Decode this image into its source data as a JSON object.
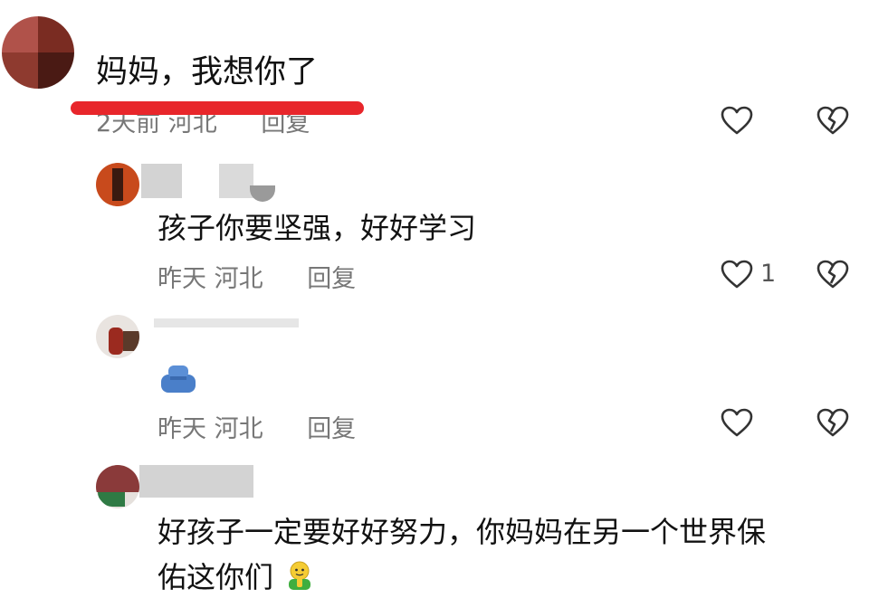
{
  "colors": {
    "text": "#111111",
    "meta": "#777777",
    "highlight_underline": "#e8262b",
    "icon_stroke": "#333333"
  },
  "comments": [
    {
      "text": "妈妈，我想你了",
      "meta": {
        "time": "2天前",
        "location": "河北",
        "reply": "回复"
      },
      "like_icon": "heart-outline-icon",
      "dislike_icon": "broken-heart-icon"
    },
    {
      "text": "孩子你要坚强，好好学习",
      "meta": {
        "time": "昨天",
        "location": "河北",
        "reply": "回复"
      },
      "like_count": "1",
      "like_icon": "heart-outline-icon",
      "dislike_icon": "broken-heart-icon"
    },
    {
      "sticker_icon": "blue-hands-sticker-icon",
      "meta": {
        "time": "昨天",
        "location": "河北",
        "reply": "回复"
      },
      "like_icon": "heart-outline-icon",
      "dislike_icon": "broken-heart-icon"
    },
    {
      "text_line1": "好孩子一定要好好努力，你妈妈在另一个世界保",
      "text_line2": "佑这你们",
      "emoji_icon": "praying-emoji-icon"
    }
  ]
}
